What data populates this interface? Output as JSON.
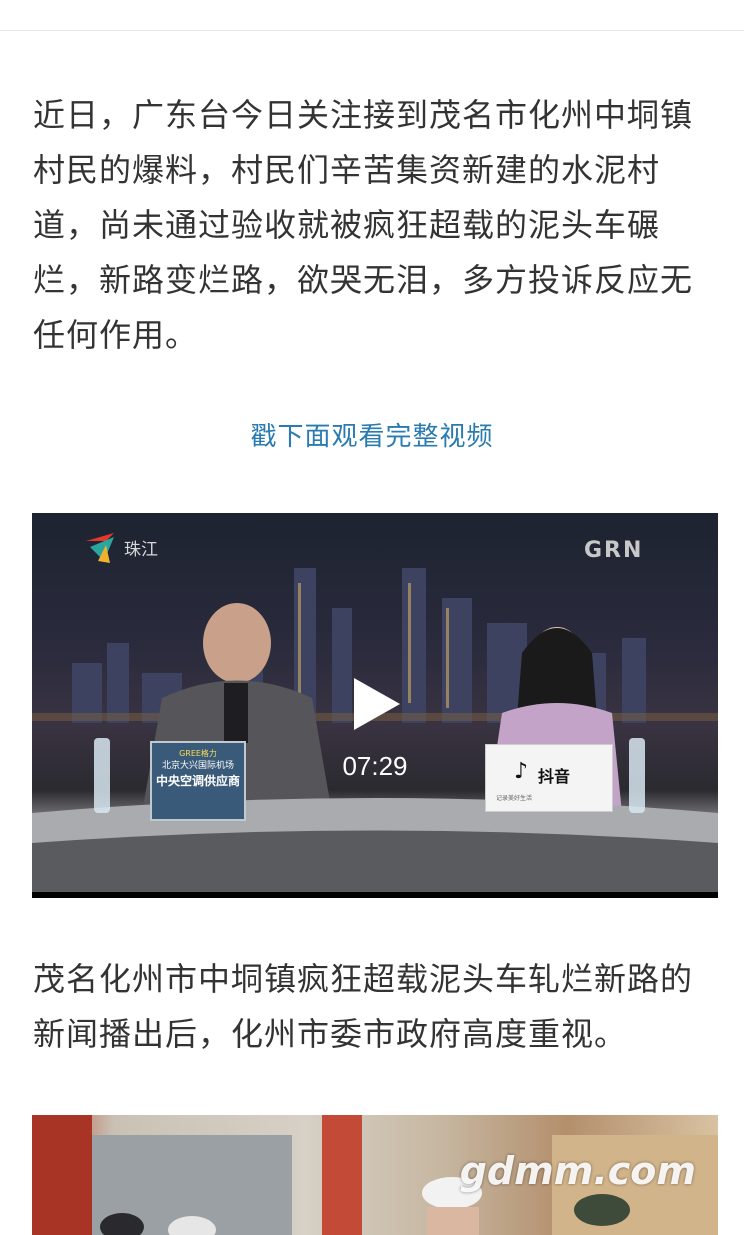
{
  "article": {
    "intro_paragraph": "近日，广东台今日关注接到茂名市化州中垌镇村民的爆料，村民们辛苦集资新建的水泥村道，尚未通过验收就被疯狂超载的泥头车碾烂，新路变烂路，欲哭无泪，多方投诉反应无任何作用。",
    "video_prompt": "戳下面观看完整视频",
    "followup_paragraph": "茂名化州市中垌镇疯狂超载泥头车轧烂新路的新闻播出后，化州市委市政府高度重视。"
  },
  "video": {
    "duration": "07:29",
    "channel_logo_text": "珠江",
    "corner_logo_text": "GRN",
    "desk_sign_left": {
      "brand": "GREE格力",
      "line1": "北京大兴国际机场",
      "line2": "中央空调供应商"
    },
    "desk_sign_right": {
      "app_name": "抖音",
      "tagline": "记录美好生活"
    }
  },
  "image2": {
    "watermark": "gdmm.com"
  },
  "colors": {
    "link_blue": "#2a7bb0",
    "body_text": "#333333"
  }
}
